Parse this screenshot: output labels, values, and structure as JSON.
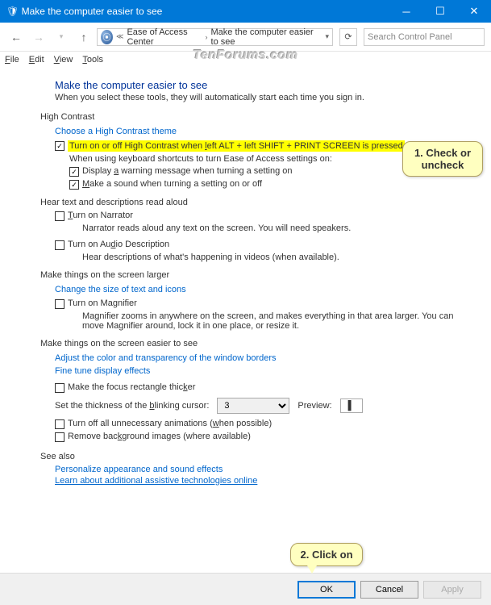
{
  "window": {
    "title": "Make the computer easier to see"
  },
  "breadcrumbs": {
    "item1": "Ease of Access Center",
    "item2": "Make the computer easier to see"
  },
  "search": {
    "placeholder": "Search Control Panel"
  },
  "menubar": {
    "file": "File",
    "edit": "Edit",
    "view": "View",
    "tools": "Tools"
  },
  "watermark": "TenForums.com",
  "heading": "Make the computer easier to see",
  "subhead": "When you select these tools, they will automatically start each time you sign in.",
  "hc": {
    "title": "High Contrast",
    "choose_theme": "Choose a High Contrast theme",
    "toggle_label": "Turn on or off High Contrast when left ALT + left SHIFT + PRINT SCREEN is pressed",
    "shortcuts_label": "When using keyboard shortcuts to turn Ease of Access settings on:",
    "warn_label": "Display a warning message when turning a setting on",
    "sound_label": "Make a sound when turning a setting on or off"
  },
  "read": {
    "title": "Hear text and descriptions read aloud",
    "narrator_label": "Turn on Narrator",
    "narrator_desc": "Narrator reads aloud any text on the screen. You will need speakers.",
    "audio_label": "Turn on Audio Description",
    "audio_desc": "Hear descriptions of what's happening in videos (when available)."
  },
  "larger": {
    "title": "Make things on the screen larger",
    "change_size": "Change the size of text and icons",
    "magnifier_label": "Turn on Magnifier",
    "magnifier_desc": "Magnifier zooms in anywhere on the screen, and makes everything in that area larger. You can move Magnifier around, lock it in one place, or resize it."
  },
  "easier": {
    "title": "Make things on the screen easier to see",
    "adjust_color": "Adjust the color and transparency of the window borders",
    "fine_tune": "Fine tune display effects",
    "focus_label": "Make the focus rectangle thicker",
    "cursor_label": "Set the thickness of the blinking cursor:",
    "cursor_value": "3",
    "preview_label": "Preview:",
    "preview_char": "|",
    "anim_label": "Turn off all unnecessary animations (when possible)",
    "bg_label": "Remove background images (where available)"
  },
  "seealso": {
    "title": "See also",
    "personalize": "Personalize appearance and sound effects",
    "learn": "Learn about additional assistive technologies online"
  },
  "buttons": {
    "ok": "OK",
    "cancel": "Cancel",
    "apply": "Apply"
  },
  "callouts": {
    "c1": "1. Check or uncheck",
    "c2": "2. Click on"
  }
}
